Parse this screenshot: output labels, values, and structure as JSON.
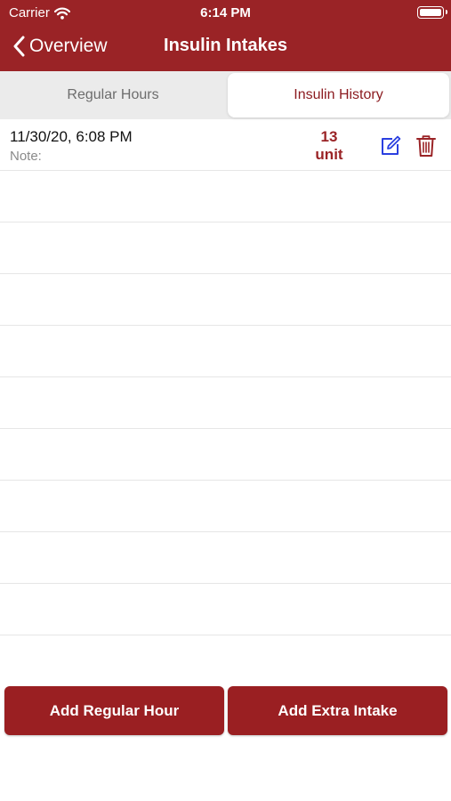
{
  "status_bar": {
    "carrier": "Carrier",
    "time": "6:14 PM"
  },
  "nav": {
    "back_label": "Overview",
    "title": "Insulin Intakes"
  },
  "segments": {
    "regular_hours": "Regular Hours",
    "insulin_history": "Insulin History",
    "selected": "Insulin History"
  },
  "entries": [
    {
      "datetime": "11/30/20, 6:08 PM",
      "note_label": "Note:",
      "amount": "13",
      "unit": "unit"
    }
  ],
  "actions": {
    "add_regular_hour": "Add Regular Hour",
    "add_extra_intake": "Add Extra Intake"
  },
  "colors": {
    "brand": "#9a2326",
    "edit_icon": "#2a3fe0",
    "delete_icon": "#9a2326"
  },
  "icons": {
    "back": "chevron-left-icon",
    "edit": "edit-icon",
    "delete": "trash-icon",
    "wifi": "wifi-icon",
    "battery": "battery-icon"
  }
}
